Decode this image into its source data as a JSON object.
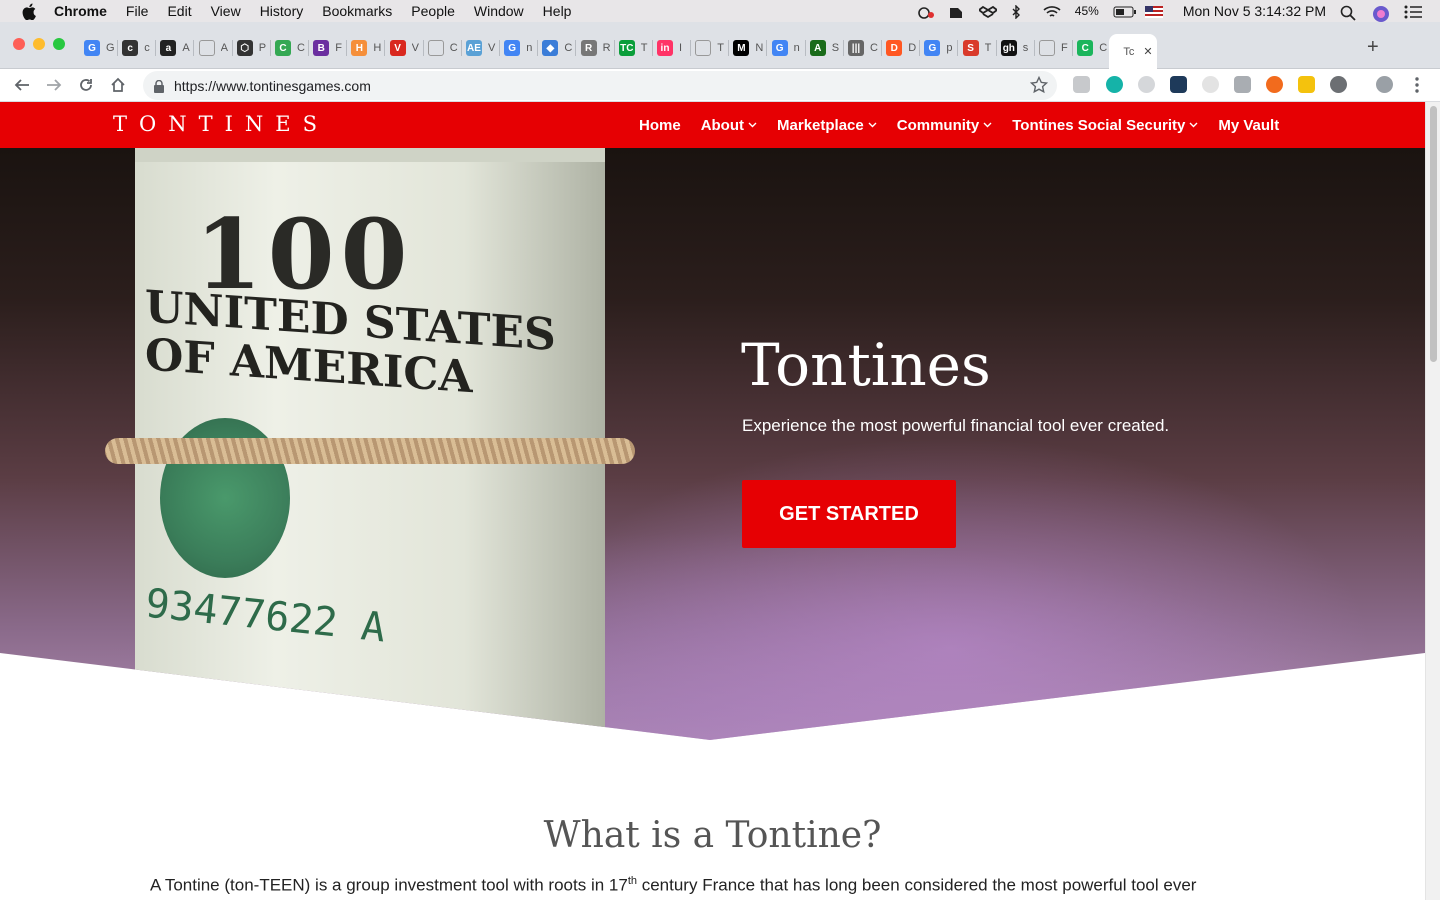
{
  "menubar": {
    "app": "Chrome",
    "items": [
      "File",
      "Edit",
      "View",
      "History",
      "Bookmarks",
      "People",
      "Window",
      "Help"
    ],
    "battery": "45%",
    "clock": "Mon Nov 5  3:14:32 PM"
  },
  "tabs": [
    {
      "letter": "G",
      "color": "#4285f4",
      "label": "G"
    },
    {
      "letter": "c",
      "color": "#333333",
      "label": "c"
    },
    {
      "letter": "a",
      "color": "#222222",
      "label": "A"
    },
    {
      "letter": "",
      "color": "#888888",
      "label": "A"
    },
    {
      "letter": "⬡",
      "color": "#333333",
      "label": "P"
    },
    {
      "letter": "C",
      "color": "#34a853",
      "label": "C"
    },
    {
      "letter": "B",
      "color": "#6b2fa0",
      "label": "F"
    },
    {
      "letter": "H",
      "color": "#f58f3a",
      "label": "H"
    },
    {
      "letter": "V",
      "color": "#d9281f",
      "label": "V"
    },
    {
      "letter": "",
      "color": "#888888",
      "label": "C"
    },
    {
      "letter": "AE",
      "color": "#5aa1d6",
      "label": "V"
    },
    {
      "letter": "G",
      "color": "#4285f4",
      "label": "n"
    },
    {
      "letter": "◆",
      "color": "#3b7dd8",
      "label": "C"
    },
    {
      "letter": "R",
      "color": "#777777",
      "label": "R"
    },
    {
      "letter": "TC",
      "color": "#0a9e3a",
      "label": "T"
    },
    {
      "letter": "in",
      "color": "#ff3366",
      "label": "I"
    },
    {
      "letter": "",
      "color": "#888888",
      "label": "T"
    },
    {
      "letter": "M",
      "color": "#000000",
      "label": "N"
    },
    {
      "letter": "G",
      "color": "#4285f4",
      "label": "n"
    },
    {
      "letter": "A",
      "color": "#1a6b1a",
      "label": "S"
    },
    {
      "letter": "|||",
      "color": "#666666",
      "label": "C"
    },
    {
      "letter": "D",
      "color": "#ff5722",
      "label": "D"
    },
    {
      "letter": "G",
      "color": "#4285f4",
      "label": "p"
    },
    {
      "letter": "S",
      "color": "#d93a2b",
      "label": "T"
    },
    {
      "letter": "gh",
      "color": "#111111",
      "label": "s"
    },
    {
      "letter": "",
      "color": "#888888",
      "label": "F"
    },
    {
      "letter": "C",
      "color": "#1bb55c",
      "label": "C"
    },
    {
      "letter": "",
      "color": "#ffffff",
      "label": "Tc",
      "active": true
    }
  ],
  "toolbar": {
    "url": "https://www.tontinesgames.com"
  },
  "site": {
    "logo": "TONTINES",
    "nav": [
      {
        "label": "Home",
        "has_dropdown": false
      },
      {
        "label": "About",
        "has_dropdown": true
      },
      {
        "label": "Marketplace",
        "has_dropdown": true
      },
      {
        "label": "Community",
        "has_dropdown": true
      },
      {
        "label": "Tontines Social Security",
        "has_dropdown": true
      },
      {
        "label": "My Vault",
        "has_dropdown": false
      }
    ],
    "hero": {
      "title": "Tontines",
      "subtitle": "Experience the most powerful financial tool ever created.",
      "cta": "GET STARTED",
      "bill_denomination": "100",
      "bill_text": "UNITED STATES OF AMERICA",
      "bill_serial": "93477622 A"
    },
    "what": {
      "heading": "What is a Tontine?",
      "body_before": "A Tontine (ton-TEEN) is a group investment tool with roots in 17",
      "body_sup": "th",
      "body_after": " century France that has long been considered the most powerful tool ever"
    }
  },
  "colors": {
    "brand_red": "#e60003",
    "menubar_bg": "#e8e6e8",
    "tabstrip_bg": "#dee1e6"
  }
}
